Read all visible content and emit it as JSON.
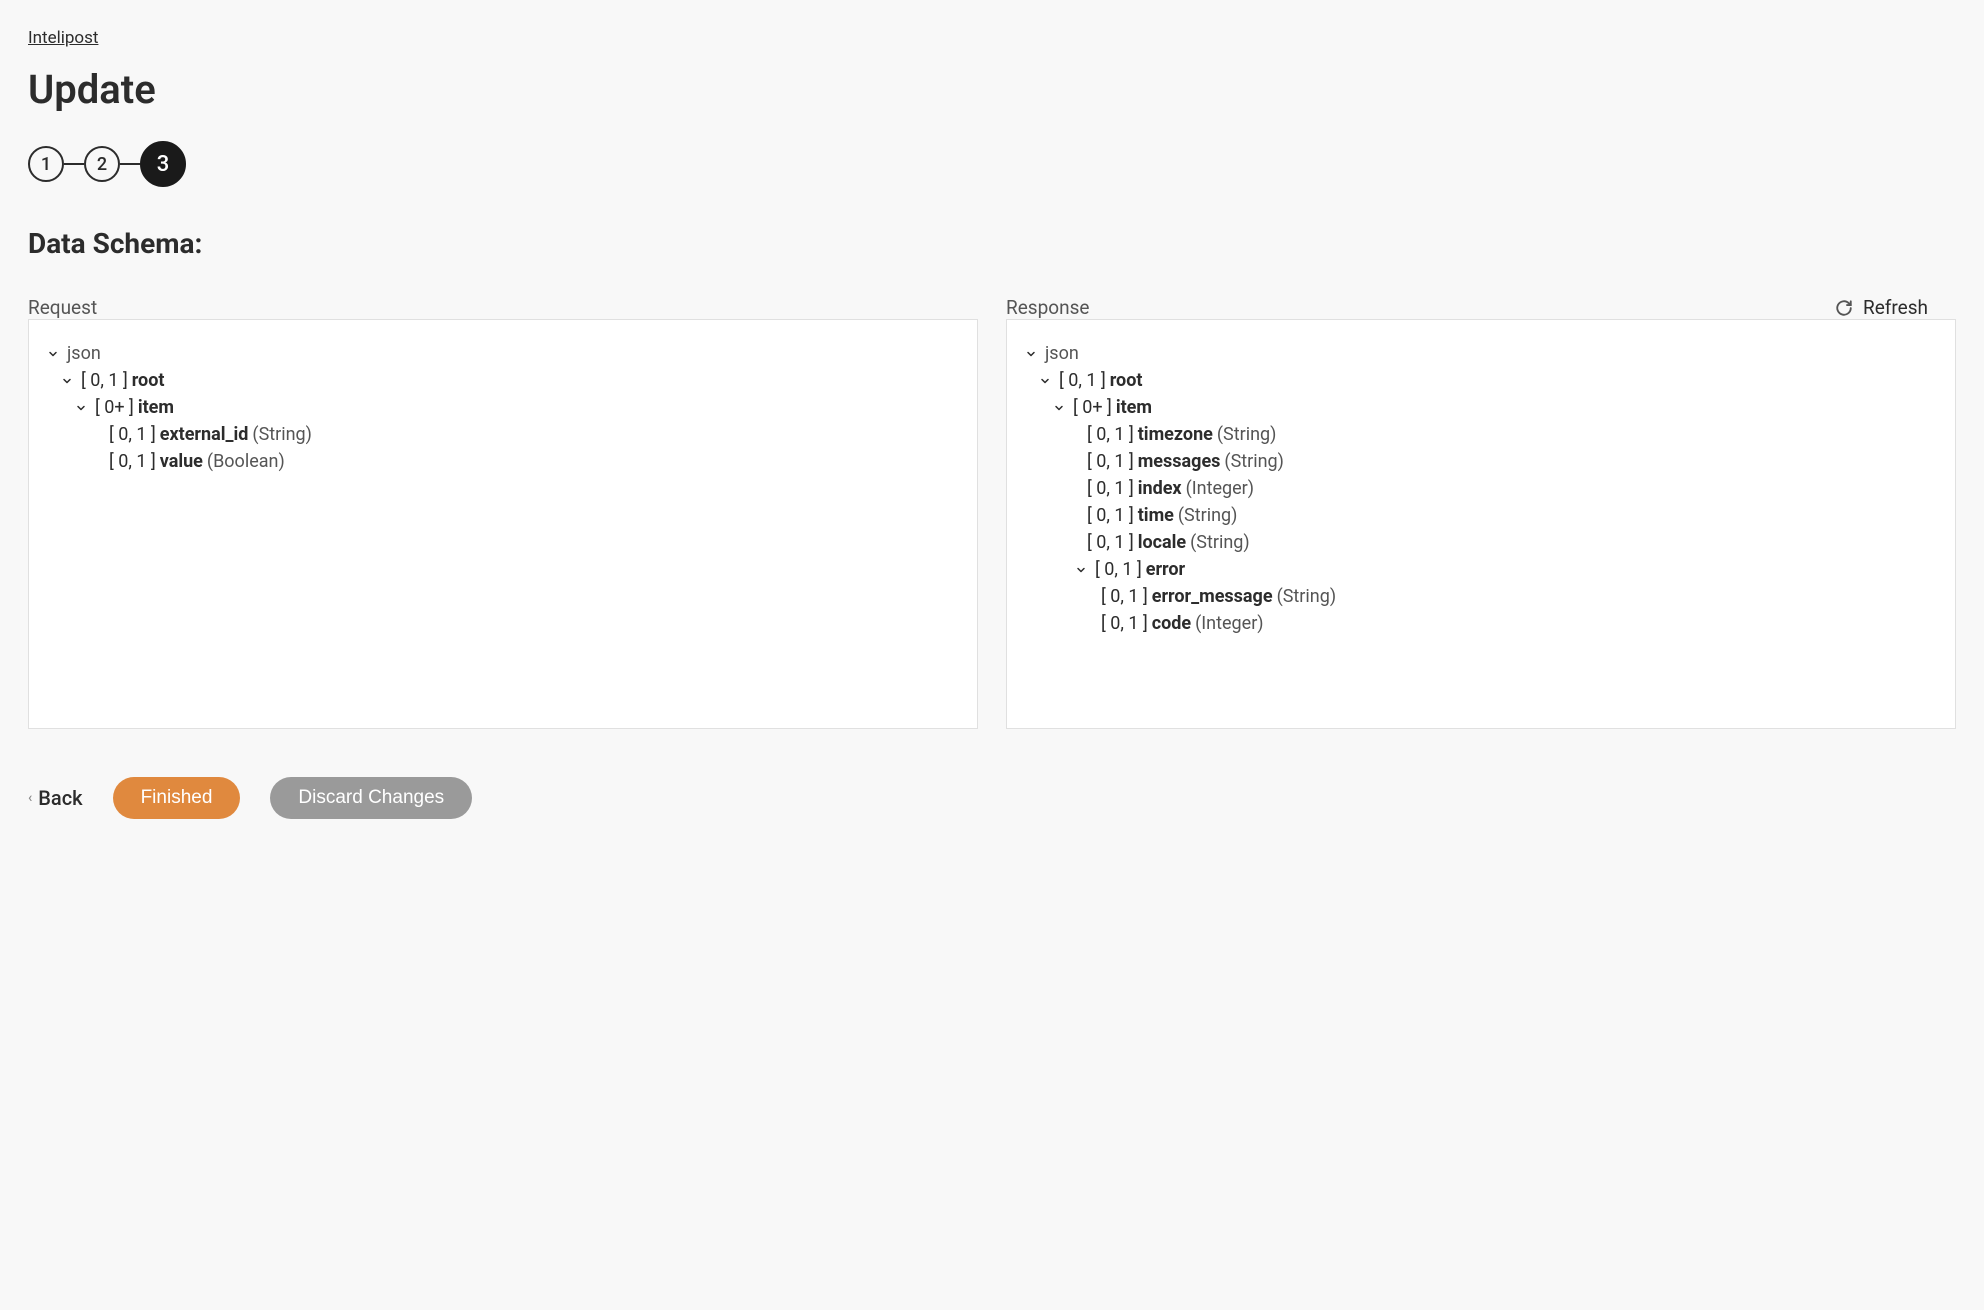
{
  "breadcrumb": "Intelipost",
  "page_title": "Update",
  "stepper": {
    "steps": [
      "1",
      "2",
      "3"
    ],
    "active_index": 2
  },
  "section_title": "Data Schema:",
  "refresh_label": "Refresh",
  "request_label": "Request",
  "response_label": "Response",
  "request_tree": {
    "root_label": "json",
    "nodes": [
      {
        "indent": 1,
        "chevron": true,
        "cardinality": "[ 0, 1 ]",
        "name": "root",
        "type": ""
      },
      {
        "indent": 2,
        "chevron": true,
        "cardinality": "[ 0+ ]",
        "name": "item",
        "type": ""
      },
      {
        "indent": 3,
        "chevron": false,
        "cardinality": "[ 0, 1 ]",
        "name": "external_id",
        "type": "(String)"
      },
      {
        "indent": 3,
        "chevron": false,
        "cardinality": "[ 0, 1 ]",
        "name": "value",
        "type": "(Boolean)"
      }
    ]
  },
  "response_tree": {
    "root_label": "json",
    "nodes": [
      {
        "indent": 1,
        "chevron": true,
        "cardinality": "[ 0, 1 ]",
        "name": "root",
        "type": ""
      },
      {
        "indent": 2,
        "chevron": true,
        "cardinality": "[ 0+ ]",
        "name": "item",
        "type": ""
      },
      {
        "indent": 3,
        "chevron": false,
        "cardinality": "[ 0, 1 ]",
        "name": "timezone",
        "type": "(String)"
      },
      {
        "indent": 3,
        "chevron": false,
        "cardinality": "[ 0, 1 ]",
        "name": "messages",
        "type": "(String)"
      },
      {
        "indent": 3,
        "chevron": false,
        "cardinality": "[ 0, 1 ]",
        "name": "index",
        "type": "(Integer)"
      },
      {
        "indent": 3,
        "chevron": false,
        "cardinality": "[ 0, 1 ]",
        "name": "time",
        "type": "(String)"
      },
      {
        "indent": 3,
        "chevron": false,
        "cardinality": "[ 0, 1 ]",
        "name": "locale",
        "type": "(String)"
      },
      {
        "indent": 3,
        "chevron": true,
        "cardinality": "[ 0, 1 ]",
        "name": "error",
        "type": ""
      },
      {
        "indent": 4,
        "chevron": false,
        "cardinality": "[ 0, 1 ]",
        "name": "error_message",
        "type": "(String)"
      },
      {
        "indent": 4,
        "chevron": false,
        "cardinality": "[ 0, 1 ]",
        "name": "code",
        "type": "(Integer)"
      }
    ]
  },
  "footer": {
    "back_label": "Back",
    "finished_label": "Finished",
    "discard_label": "Discard Changes"
  }
}
